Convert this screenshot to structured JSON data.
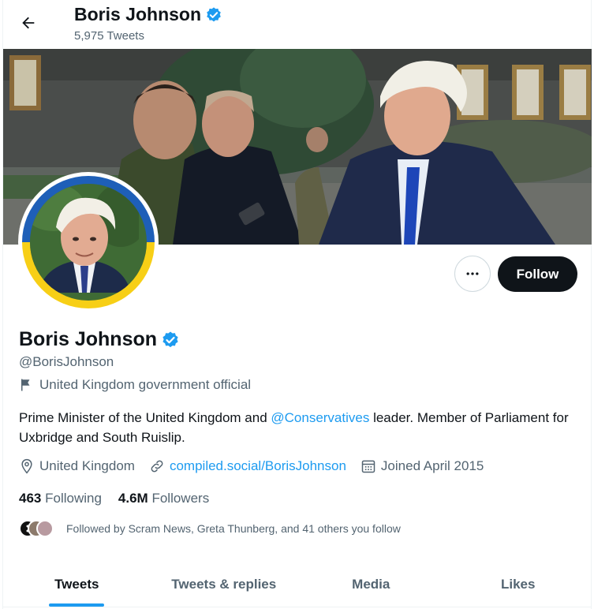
{
  "header": {
    "title": "Boris Johnson",
    "tweet_count": "5,975 Tweets"
  },
  "profile": {
    "name": "Boris Johnson",
    "handle": "@BorisJohnson",
    "affiliation_label": "United Kingdom government official",
    "bio_before": "Prime Minister of the United Kingdom and ",
    "bio_mention": "@Conservatives",
    "bio_after": " leader. Member of Parliament for Uxbridge and South Ruislip.",
    "location": "United Kingdom",
    "website": "compiled.social/BorisJohnson",
    "joined": "Joined April 2015",
    "following_count": "463",
    "following_label": "Following",
    "followers_count": "4.6M",
    "followers_label": "Followers",
    "followed_by": "Followed by Scram News, Greta Thunberg, and 41 others you follow"
  },
  "actions": {
    "follow_label": "Follow"
  },
  "tabs": [
    {
      "label": "Tweets",
      "active": true
    },
    {
      "label": "Tweets & replies",
      "active": false
    },
    {
      "label": "Media",
      "active": false
    },
    {
      "label": "Likes",
      "active": false
    }
  ],
  "colors": {
    "accent": "#1d9bf0",
    "follow_button_bg": "#0f1419",
    "muted_text": "#536471",
    "avatar_ring_top": "#1e5fb8",
    "avatar_ring_bottom": "#f7cf16"
  },
  "icons": {
    "back": "arrow-left-icon",
    "verified": "verified-badge-icon",
    "more": "more-dots-icon",
    "affiliation": "flag-icon",
    "location": "location-pin-icon",
    "website": "link-icon",
    "joined": "calendar-icon"
  }
}
